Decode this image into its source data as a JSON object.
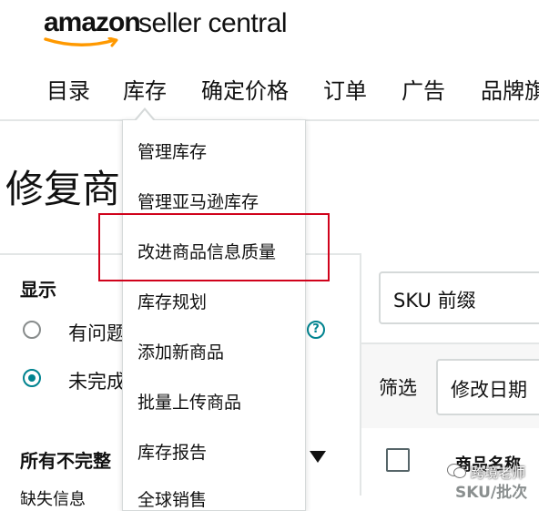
{
  "logo": {
    "brand": "amazon",
    "product": "seller central"
  },
  "nav": {
    "items": [
      "目录",
      "库存",
      "确定价格",
      "订单",
      "广告",
      "品牌旗"
    ]
  },
  "page": {
    "title": "修复商"
  },
  "dropdown": {
    "items": [
      "管理库存",
      "管理亚马逊库存",
      "改进商品信息质量",
      "库存规划",
      "添加新商品",
      "批量上传商品",
      "库存报告",
      "全球销售"
    ],
    "highlighted_index": 2,
    "highlight_color": "#d0021b"
  },
  "left_panel": {
    "show_label": "显示",
    "radio_options": [
      {
        "label": "有问题",
        "selected": false
      },
      {
        "label": "未完成",
        "selected": true
      }
    ],
    "help_icon": "?",
    "incomplete_label": "所有不完整",
    "bottom_text": "缺失信息"
  },
  "right_panel": {
    "search_field_value": "SKU 前缀",
    "filter_label": "筛选",
    "filter_value": "修改日期",
    "column_header": "商品名称",
    "column_subheader": "SKU/批次"
  },
  "watermark": {
    "text": "跨境老师"
  },
  "colors": {
    "accent": "#00838f",
    "highlight": "#d0021b",
    "divider": "#e3e6e6"
  }
}
